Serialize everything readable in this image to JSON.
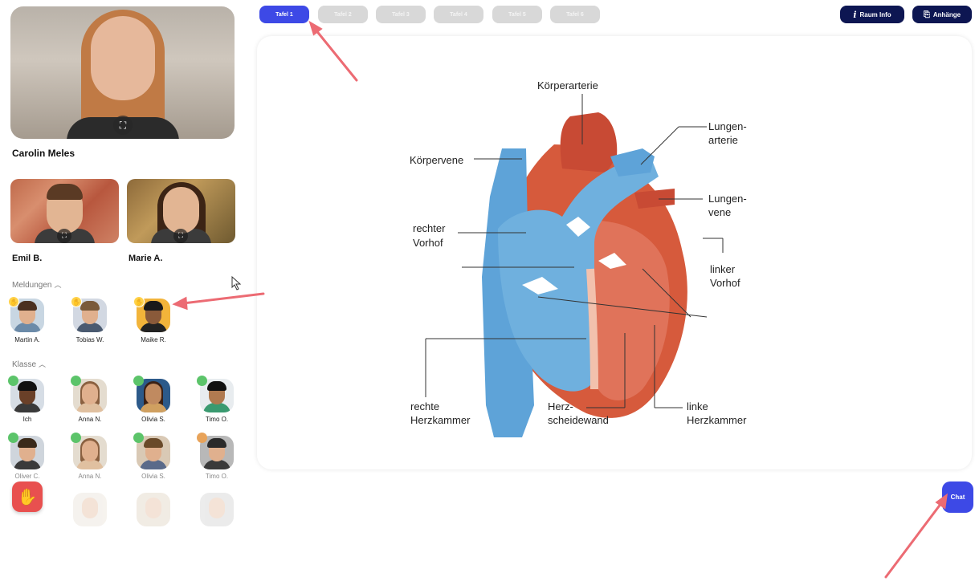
{
  "tabs": [
    {
      "label": "Tafel 1",
      "active": true
    },
    {
      "label": "Tafel 2",
      "active": false
    },
    {
      "label": "Tafel 3",
      "active": false
    },
    {
      "label": "Tafel 4",
      "active": false
    },
    {
      "label": "Tafel 5",
      "active": false
    },
    {
      "label": "Tafel 6",
      "active": false
    }
  ],
  "header": {
    "room_info_label": "Raum Info",
    "attachments_label": "Anhänge"
  },
  "teacher": {
    "name": "Carolin Meles"
  },
  "participants_video": [
    {
      "name": "Emil B."
    },
    {
      "name": "Marie A."
    }
  ],
  "messages_section": {
    "label": "Meldungen",
    "items": [
      {
        "name": "Martin A."
      },
      {
        "name": "Tobias W."
      },
      {
        "name": "Maike R."
      }
    ]
  },
  "class_section": {
    "label": "Klasse",
    "rows": [
      [
        "Ich",
        "Anna N.",
        "Olivia S.",
        "Timo O."
      ],
      [
        "Oliver C.",
        "Anna N.",
        "Olivia S.",
        "Timo O."
      ]
    ]
  },
  "heart_diagram": {
    "labels": {
      "koerperarterie": "Körperarterie",
      "lungenarterie_1": "Lungen-",
      "lungenarterie_2": "arterie",
      "koerpervene": "Körpervene",
      "lungenvene_1": "Lungen-",
      "lungenvene_2": "vene",
      "rechter_vorhof_1": "rechter",
      "rechter_vorhof_2": "Vorhof",
      "linker_vorhof_1": "linker",
      "linker_vorhof_2": "Vorhof",
      "rechte_herzkammer_1": "rechte",
      "rechte_herzkammer_2": "Herzkammer",
      "herzscheidewand_1": "Herz-",
      "herzscheidewand_2": "scheidewand",
      "linke_herzkammer_1": "linke",
      "linke_herzkammer_2": "Herzkammer"
    }
  },
  "chat_label": "Chat",
  "colors": {
    "accent": "#3d49e6",
    "dark_button": "#0d1652",
    "online": "#5cc46a",
    "away": "#e8a35a",
    "raise_hand": "#e8504f",
    "arrow": "#ec6b73"
  }
}
